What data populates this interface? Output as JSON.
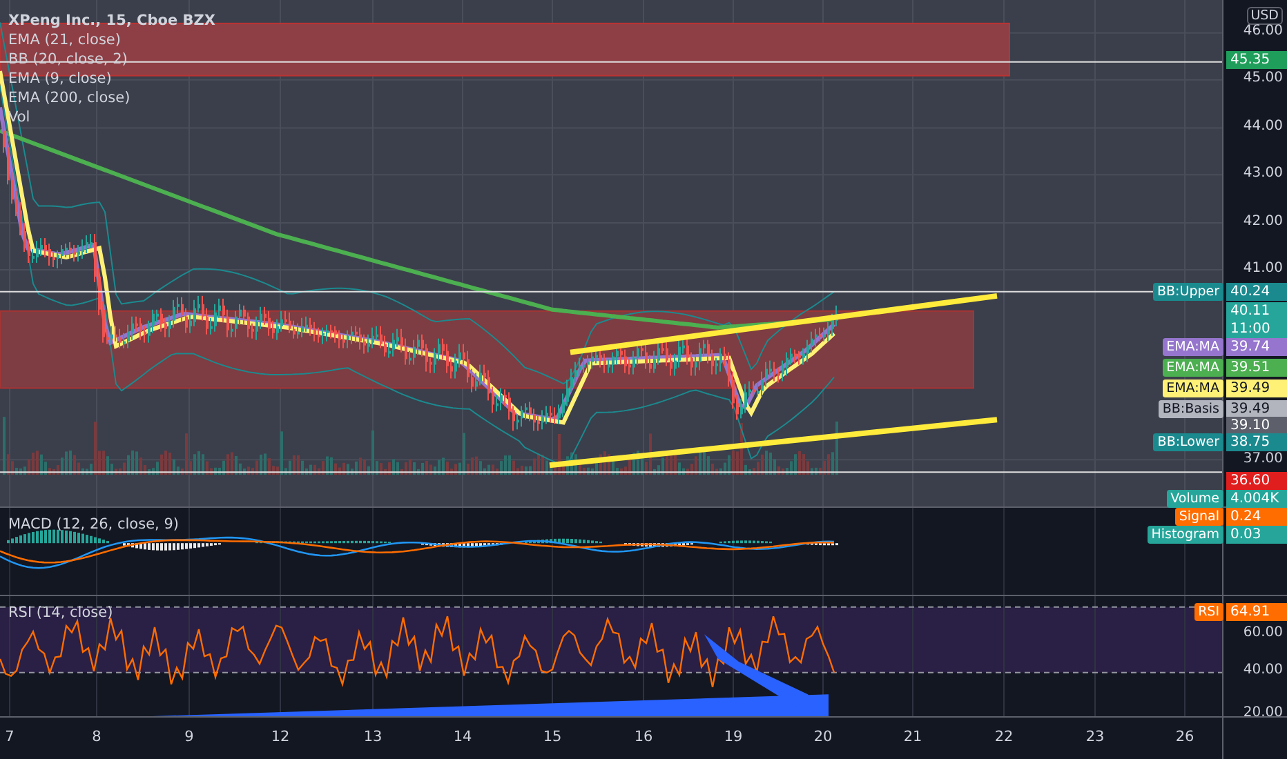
{
  "legend": {
    "title": "XPeng Inc., 15, Cboe BZX",
    "indicators": [
      "EMA (21, close)",
      "BB (20, close, 2)",
      "EMA (9, close)",
      "EMA (200, close)",
      "Vol"
    ]
  },
  "price_axis": {
    "currency": "USD",
    "ticks": [
      "46.00",
      "45.00",
      "44.00",
      "43.00",
      "42.00",
      "41.00",
      "37.00"
    ]
  },
  "macd": {
    "legend": "MACD (12, 26, close, 9)"
  },
  "rsi": {
    "legend": "RSI (14, close)",
    "ticks": [
      "60.00",
      "40.00",
      "20.00"
    ]
  },
  "price_labels": [
    {
      "value": "45.35",
      "color": "#1e9e5a"
    },
    {
      "tag": "BB:Upper",
      "value": "40.24",
      "color": "#1b8a8f"
    },
    {
      "value": "40.11",
      "time": "11:00",
      "color": "#26a69a"
    },
    {
      "tag": "EMA:MA",
      "value": "39.74",
      "color": "#9575cd"
    },
    {
      "tag": "EMA:MA",
      "value": "39.51",
      "color": "#4caf50"
    },
    {
      "tag": "EMA:MA",
      "value": "39.49",
      "color": "#fff176"
    },
    {
      "tag": "BB:Basis",
      "value": "39.49",
      "color": "#b2b5be"
    },
    {
      "value": "39.10",
      "color": "#5d606b"
    },
    {
      "tag": "BB:Lower",
      "value": "38.75",
      "color": "#1b8a8f"
    },
    {
      "value": "36.60",
      "color": "#e01e1e"
    },
    {
      "tag": "Volume",
      "value": "4.004K",
      "color": "#26a69a"
    },
    {
      "tag": "Signal",
      "value": "0.24",
      "color": "#ff6d00"
    },
    {
      "tag": "Histogram",
      "value": "0.03",
      "color": "#26a69a"
    },
    {
      "tag": "RSI",
      "value": "64.91",
      "color": "#ff6d00"
    }
  ],
  "time_axis": [
    "7",
    "8",
    "9",
    "12",
    "13",
    "14",
    "15",
    "16",
    "19",
    "20",
    "21",
    "22",
    "23",
    "26"
  ]
}
